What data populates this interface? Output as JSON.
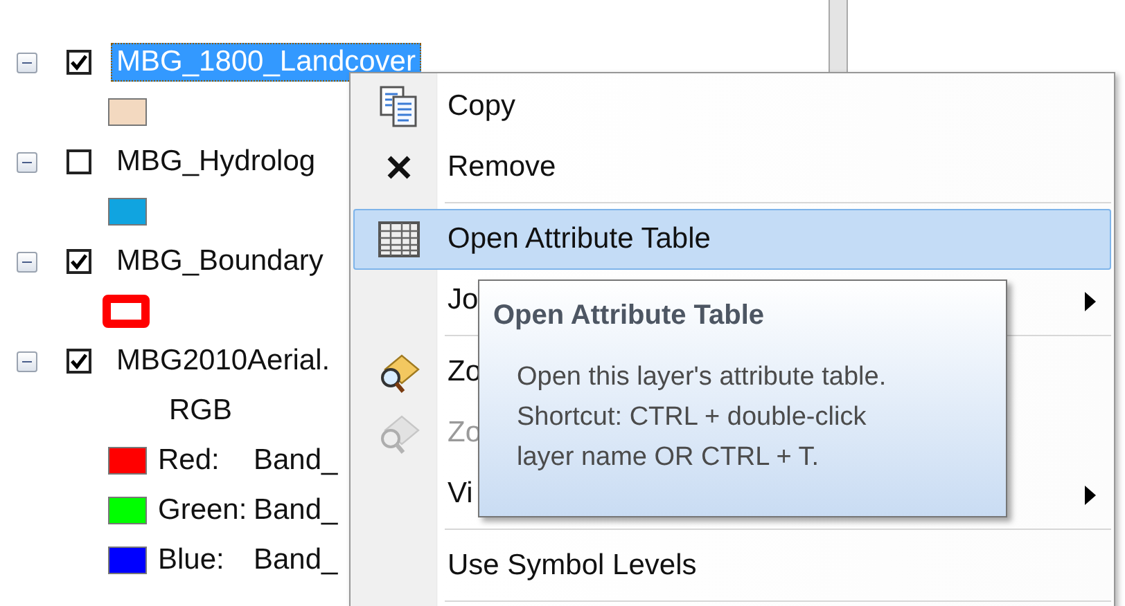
{
  "layers": [
    {
      "name": "MBG_1800_Landcover",
      "checked": true,
      "selected": true,
      "expanded": true,
      "legend": [
        {
          "kind": "fill",
          "color": "#f3d9c0"
        }
      ]
    },
    {
      "name": "MBG_Hydrolog",
      "checked": false,
      "selected": false,
      "expanded": true,
      "legend": [
        {
          "kind": "fill",
          "color": "#10a4e0"
        }
      ]
    },
    {
      "name": "MBG_Boundary",
      "checked": true,
      "selected": false,
      "expanded": true,
      "legend": [
        {
          "kind": "outline",
          "color": "#ff0000"
        }
      ]
    },
    {
      "name": "MBG2010Aerial.",
      "checked": true,
      "selected": false,
      "expanded": true,
      "legend": [
        {
          "kind": "heading",
          "label": "RGB"
        },
        {
          "kind": "band",
          "color": "#ff0000",
          "label": "Red:",
          "value": "Band_"
        },
        {
          "kind": "band",
          "color": "#00ff00",
          "label": "Green:",
          "value": "Band_"
        },
        {
          "kind": "band",
          "color": "#0000ff",
          "label": "Blue:",
          "value": "Band_"
        }
      ]
    }
  ],
  "menu": [
    {
      "kind": "item",
      "label": "Copy",
      "selected": false,
      "disabled": false,
      "submenu": false
    },
    {
      "kind": "item",
      "label": "Remove",
      "selected": false,
      "disabled": false,
      "submenu": false
    },
    {
      "kind": "separator"
    },
    {
      "kind": "item",
      "label": "Open Attribute Table",
      "selected": true,
      "disabled": false,
      "submenu": false
    },
    {
      "kind": "item",
      "label": "Jo",
      "selected": false,
      "disabled": false,
      "submenu": true
    },
    {
      "kind": "separator"
    },
    {
      "kind": "item",
      "label": "Zo",
      "selected": false,
      "disabled": false,
      "submenu": false
    },
    {
      "kind": "item",
      "label": "Zo",
      "selected": false,
      "disabled": true,
      "submenu": false
    },
    {
      "kind": "item",
      "label": "Vi",
      "selected": false,
      "disabled": false,
      "submenu": true
    },
    {
      "kind": "separator"
    },
    {
      "kind": "item",
      "label": "Use Symbol Levels",
      "selected": false,
      "disabled": false,
      "submenu": false
    },
    {
      "kind": "separator"
    }
  ],
  "tooltip": {
    "title": "Open Attribute Table",
    "lines": [
      "Open this layer's attribute table.",
      "Shortcut: CTRL + double-click",
      "layer name OR CTRL + T."
    ]
  }
}
